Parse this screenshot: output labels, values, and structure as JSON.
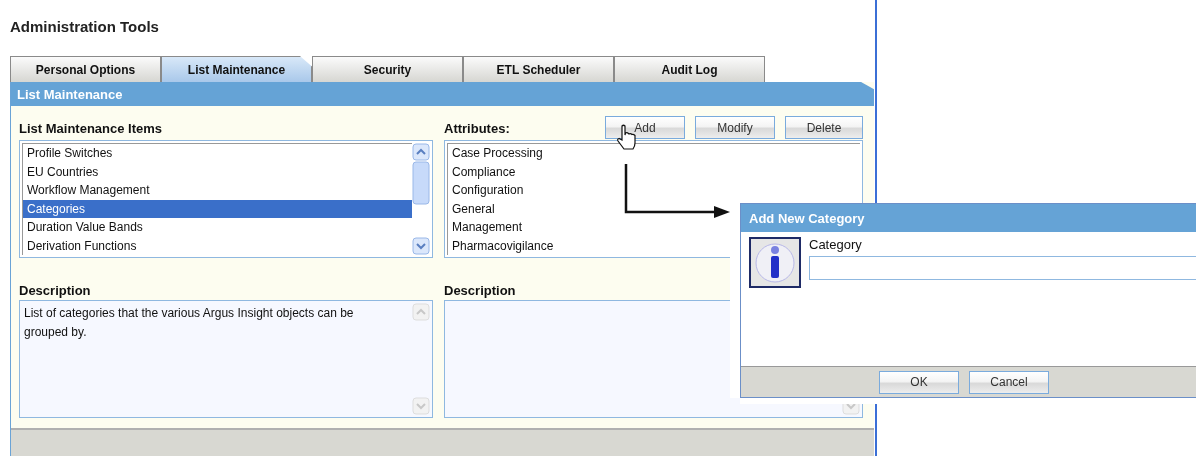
{
  "page_title": "Administration Tools",
  "tabs": [
    {
      "label": "Personal Options",
      "selected": false
    },
    {
      "label": "List Maintenance",
      "selected": true
    },
    {
      "label": "Security",
      "selected": false
    },
    {
      "label": "ETL Scheduler",
      "selected": false
    },
    {
      "label": "Audit Log",
      "selected": false
    }
  ],
  "panel": {
    "title": "List Maintenance",
    "items_label": "List Maintenance Items",
    "items": [
      {
        "label": "Profile Switches",
        "selected": false
      },
      {
        "label": "EU Countries",
        "selected": false
      },
      {
        "label": "Workflow Management",
        "selected": false
      },
      {
        "label": "Categories",
        "selected": true
      },
      {
        "label": "Duration Value Bands",
        "selected": false
      },
      {
        "label": "Derivation Functions",
        "selected": false
      }
    ],
    "attributes_label": "Attributes:",
    "buttons": [
      "Add",
      "Modify",
      "Delete"
    ],
    "attributes": [
      "Case Processing",
      "Compliance",
      "Configuration",
      "General",
      "Management",
      "Pharmacovigilance"
    ],
    "description_label": "Description",
    "description": "List of categories that the various Argus Insight objects can be grouped by.",
    "attribute_description_label": "Description"
  },
  "dialog": {
    "title": "Add New Category",
    "field_label": "Category",
    "buttons": [
      "OK",
      "Cancel"
    ]
  }
}
